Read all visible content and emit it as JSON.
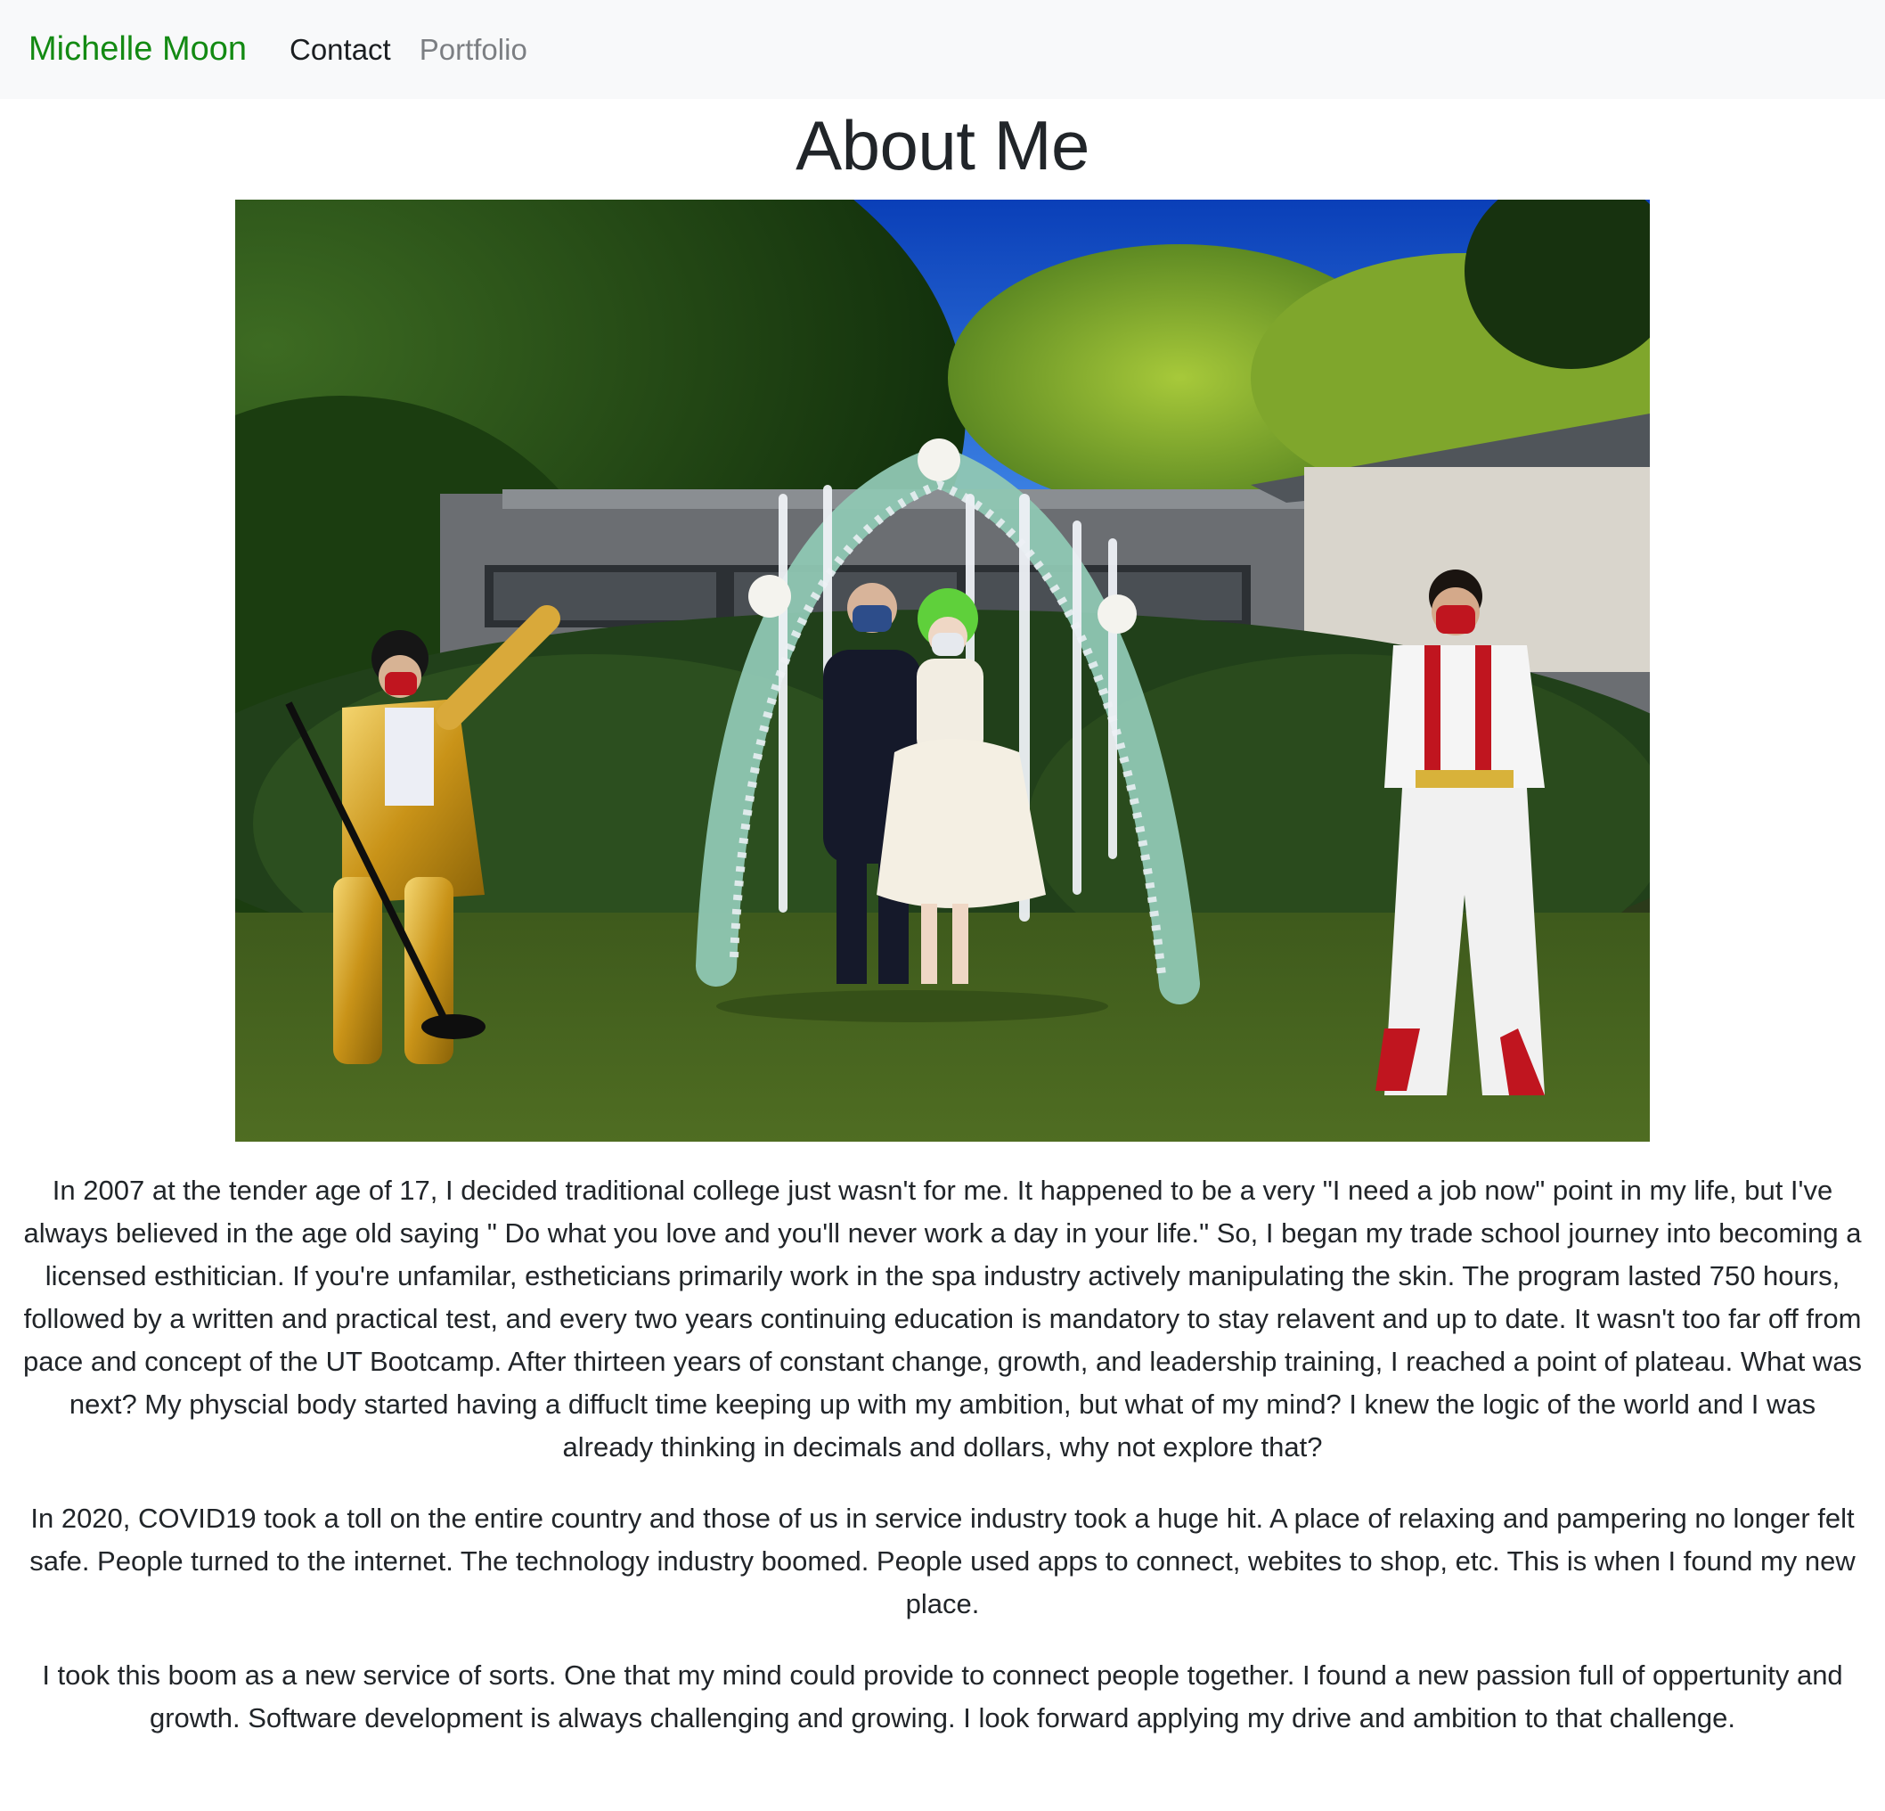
{
  "navbar": {
    "brand": "Michelle Moon",
    "links": [
      {
        "label": "Contact"
      },
      {
        "label": "Portfolio"
      }
    ]
  },
  "page": {
    "title": "About Me"
  },
  "bio": {
    "paragraphs": [
      "In 2007 at the tender age of 17, I decided traditional college just wasn't for me. It happened to be a very \"I need a job now\" point in my life, but I've always believed in the age old saying \" Do what you love and you'll never work a day in your life.\" So, I began my trade school journey into becoming a licensed esthitician. If you're unfamilar, estheticians primarily work in the spa industry actively manipulating the skin. The program lasted 750 hours, followed by a written and practical test, and every two years continuing education is mandatory to stay relavent and up to date. It wasn't too far off from pace and concept of the UT Bootcamp. After thirteen years of constant change, growth, and leadership training, I reached a point of plateau. What was next? My physcial body started having a diffuclt time keeping up with my ambition, but what of my mind? I knew the logic of the world and I was already thinking in decimals and dollars, why not explore that?",
      "In 2020, COVID19 took a toll on the entire country and those of us in service industry took a huge hit. A place of relaxing and pampering no longer felt safe. People turned to the internet. The technology industry boomed. People used apps to connect, webites to shop, etc. This is when I found my new place.",
      "I took this boom as a new service of sorts. One that my mind could provide to connect people together. I found a new passion full of oppertunity and growth. Software development is always challenging and growing. I look forward applying my drive and ambition to that challenge."
    ]
  },
  "colors": {
    "brand": "#138a13",
    "navbar_bg": "#f8f9fa",
    "text": "#212529",
    "muted_link": "#7c7f83"
  }
}
